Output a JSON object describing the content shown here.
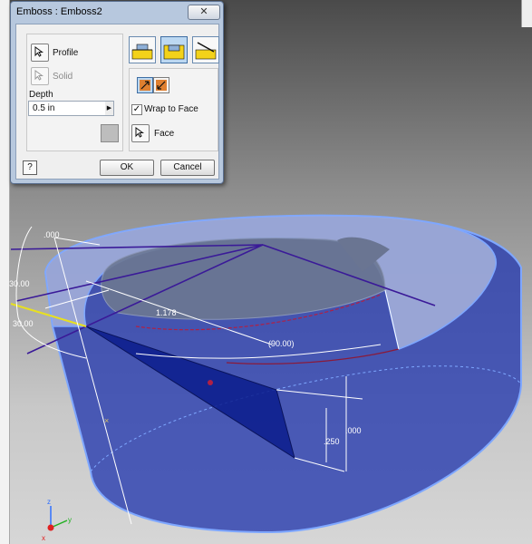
{
  "dialog": {
    "title": "Emboss : Emboss2",
    "close_glyph": "✕",
    "profile_label": "Profile",
    "solid_label": "Solid",
    "depth_label": "Depth",
    "depth_value": "0.5 in",
    "wrap_label": "Wrap to Face",
    "wrap_checked": "✓",
    "face_label": "Face",
    "help_glyph": "?",
    "ok_label": "OK",
    "cancel_label": "Cancel",
    "icons": {
      "profile": "select-arrow-icon",
      "solid": "select-arrow-icon",
      "emboss_type": [
        "emboss-from-face-icon",
        "engrave-from-face-icon",
        "emboss-engrave-from-plane-icon"
      ],
      "direction": [
        "direction-flip-1-icon",
        "direction-flip-2-icon"
      ],
      "face": "select-arrow-icon",
      "help": "help-icon"
    }
  },
  "viewport": {
    "dimensions": [
      ".000",
      "30.00",
      "30.00",
      "1.178",
      "(90.00)",
      ".000",
      ".250"
    ],
    "colors": {
      "body": "#2c3fb0",
      "edges": "#7ea7ff",
      "sketch": "#3a1a98",
      "dimension": "#ffffff",
      "face": "#1a2c99",
      "accent": "#b02045"
    },
    "icons": [
      "view-triad-icon"
    ]
  }
}
